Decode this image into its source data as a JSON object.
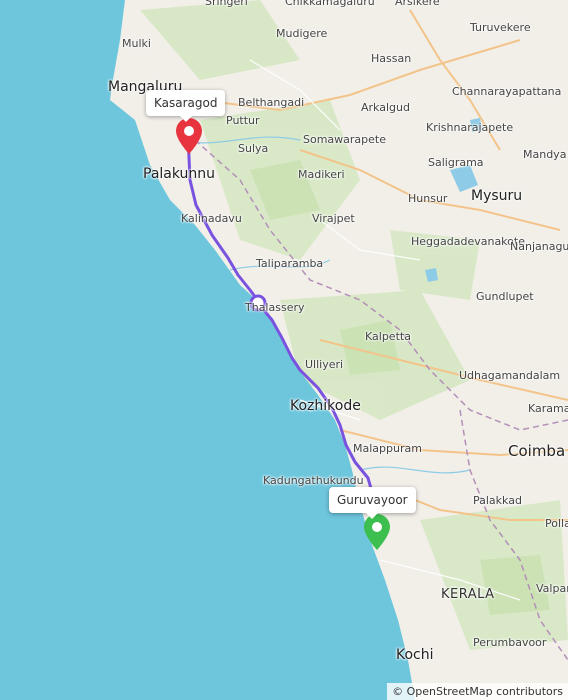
{
  "map": {
    "places": [
      {
        "name": "Sringeri",
        "cls": ""
      },
      {
        "name": "Chikkamagaluru",
        "cls": ""
      },
      {
        "name": "Arsikere",
        "cls": ""
      },
      {
        "name": "Mulki",
        "cls": ""
      },
      {
        "name": "Mudigere",
        "cls": ""
      },
      {
        "name": "Turuvekere",
        "cls": ""
      },
      {
        "name": "Hassan",
        "cls": ""
      },
      {
        "name": "Mangaluru",
        "cls": "city"
      },
      {
        "name": "Belthangadi",
        "cls": ""
      },
      {
        "name": "Channarayapattana",
        "cls": ""
      },
      {
        "name": "Arkalgud",
        "cls": ""
      },
      {
        "name": "Puttur",
        "cls": ""
      },
      {
        "name": "Krishnarajapete",
        "cls": ""
      },
      {
        "name": "Somawarapete",
        "cls": ""
      },
      {
        "name": "Sulya",
        "cls": ""
      },
      {
        "name": "Saligrama",
        "cls": ""
      },
      {
        "name": "Mandya",
        "cls": ""
      },
      {
        "name": "Palakunnu",
        "cls": "city"
      },
      {
        "name": "Madikeri",
        "cls": ""
      },
      {
        "name": "Hunsur",
        "cls": ""
      },
      {
        "name": "Mysuru",
        "cls": "city"
      },
      {
        "name": "Kalinadavu",
        "cls": ""
      },
      {
        "name": "Virajpet",
        "cls": ""
      },
      {
        "name": "Heggadadevanakote",
        "cls": ""
      },
      {
        "name": "Nanjanagud",
        "cls": ""
      },
      {
        "name": "Taliparamba",
        "cls": ""
      },
      {
        "name": "Gundlupet",
        "cls": ""
      },
      {
        "name": "Thalassery",
        "cls": ""
      },
      {
        "name": "Kalpetta",
        "cls": ""
      },
      {
        "name": "Ulliyeri",
        "cls": ""
      },
      {
        "name": "Udhagamandalam",
        "cls": ""
      },
      {
        "name": "Kozhikode",
        "cls": "city"
      },
      {
        "name": "Karama",
        "cls": ""
      },
      {
        "name": "Malappuram",
        "cls": ""
      },
      {
        "name": "Coimba",
        "cls": "big"
      },
      {
        "name": "Kadungathukundu",
        "cls": ""
      },
      {
        "name": "Palakkad",
        "cls": ""
      },
      {
        "name": "Polla",
        "cls": ""
      },
      {
        "name": "KERALA",
        "cls": "region"
      },
      {
        "name": "Valpara",
        "cls": ""
      },
      {
        "name": "Perumbavoor",
        "cls": ""
      },
      {
        "name": "Kochi",
        "cls": "city"
      }
    ],
    "popups": {
      "start": "Kasaragod",
      "end": "Guruvayoor"
    },
    "colors": {
      "sea": "#6ec6dd",
      "land": "#f2efe9",
      "route": "#7a52e0",
      "start_marker": "#e8343f",
      "end_marker": "#3cbf4e"
    },
    "attribution": "© OpenStreetMap contributors"
  }
}
